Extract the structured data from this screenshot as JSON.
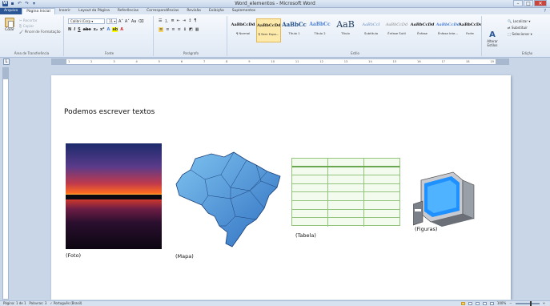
{
  "window": {
    "title": "Word_elementos - Microsoft Word",
    "controls": {
      "minimize": "–",
      "maximize": "□",
      "close": "✕"
    }
  },
  "tabs": [
    "Arquivo",
    "Página Inicial",
    "Inserir",
    "Layout da Página",
    "Referências",
    "Correspondências",
    "Revisão",
    "Exibição",
    "Suplementos"
  ],
  "clipboard": {
    "paste_label": "Colar",
    "items": [
      "Recortar",
      "Copiar",
      "Pincel de Formatação"
    ],
    "group_label": "Área de Transferência"
  },
  "font": {
    "family": "Calibri (Corp",
    "size": "11",
    "group_label": "Fonte"
  },
  "paragraph": {
    "group_label": "Parágrafo"
  },
  "styles": {
    "items": [
      {
        "sample": "AaBbCcDd",
        "name": "¶ Normal"
      },
      {
        "sample": "AaBbCcDd",
        "name": "¶ Sem Espa..."
      },
      {
        "sample": "AaBbCc",
        "name": "Título 1"
      },
      {
        "sample": "AaBbCc",
        "name": "Título 2"
      },
      {
        "sample": "AaB",
        "name": "Título"
      },
      {
        "sample": "AaBbCcI",
        "name": "Subtítulo"
      },
      {
        "sample": "AaBbCcDd",
        "name": "Ênfase Sutil"
      },
      {
        "sample": "AaBbCcDd",
        "name": "Ênfase"
      },
      {
        "sample": "AaBbCcDd",
        "name": "Ênfase Inte..."
      },
      {
        "sample": "AaBbCcDd",
        "name": "Forte"
      }
    ],
    "active_index": 1,
    "alter_label": "Alterar Estilos",
    "group_label": "Estilo"
  },
  "editing": {
    "items": [
      "Localizar",
      "Substituir",
      "Selecionar"
    ],
    "group_label": "Edição"
  },
  "document": {
    "heading": "Podemos escrever textos",
    "captions": {
      "foto": "(Foto)",
      "mapa": "(Mapa)",
      "tabela": "(Tabela)",
      "figuras": "(Figuras)"
    },
    "table": {
      "rows": 8,
      "cols": 3
    }
  },
  "statusbar": {
    "page": "Página: 1 de 1",
    "words": "Palavras: 3",
    "language": "Português (Brasil)",
    "zoom": "100%"
  },
  "colors": {
    "ribbon_blue": "#2b5797",
    "table_green": "#93c47d",
    "style_active": "#fde9a9"
  }
}
